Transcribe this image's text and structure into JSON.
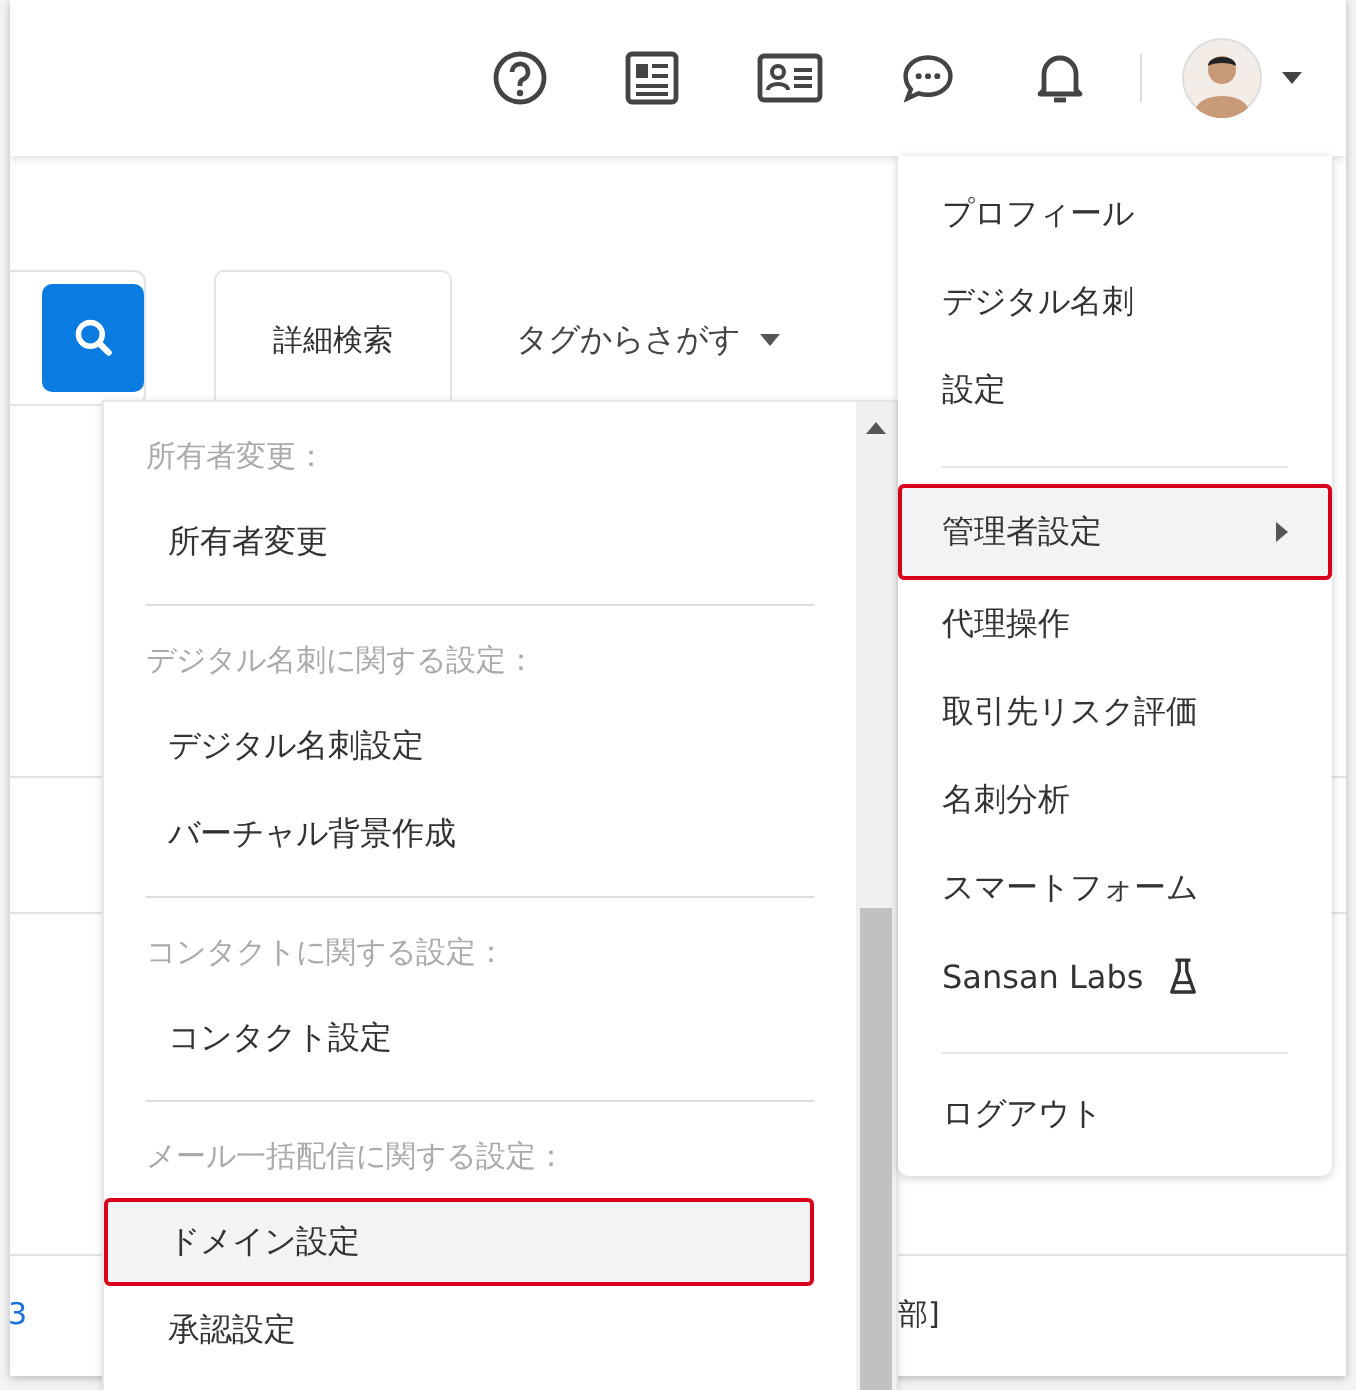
{
  "search": {
    "advanced_button": "詳細検索",
    "tag_dropdown": "タグからさがす"
  },
  "background_row": {
    "row_number": "3",
    "cell_fragment": "部]"
  },
  "admin_menu": {
    "sections": [
      {
        "heading": "所有者変更：",
        "items": [
          {
            "label": "所有者変更",
            "selected": false
          }
        ]
      },
      {
        "heading": "デジタル名刺に関する設定：",
        "items": [
          {
            "label": "デジタル名刺設定",
            "selected": false
          },
          {
            "label": "バーチャル背景作成",
            "selected": false
          }
        ]
      },
      {
        "heading": "コンタクトに関する設定：",
        "items": [
          {
            "label": "コンタクト設定",
            "selected": false
          }
        ]
      },
      {
        "heading": "メール一括配信に関する設定：",
        "items": [
          {
            "label": "ドメイン設定",
            "selected": true
          },
          {
            "label": "承認設定",
            "selected": false
          }
        ]
      }
    ]
  },
  "user_menu": {
    "groups": [
      [
        {
          "label": "プロフィール",
          "kind": "item",
          "selected": false
        },
        {
          "label": "デジタル名刺",
          "kind": "item",
          "selected": false
        },
        {
          "label": "設定",
          "kind": "item",
          "selected": false
        }
      ],
      [
        {
          "label": "管理者設定",
          "kind": "submenu",
          "selected": true
        },
        {
          "label": "代理操作",
          "kind": "item",
          "selected": false
        },
        {
          "label": "取引先リスク評価",
          "kind": "item",
          "selected": false
        },
        {
          "label": "名刺分析",
          "kind": "item",
          "selected": false
        },
        {
          "label": "スマートフォーム",
          "kind": "item",
          "selected": false
        },
        {
          "label": "Sansan Labs",
          "kind": "labs",
          "selected": false
        }
      ],
      [
        {
          "label": "ログアウト",
          "kind": "item",
          "selected": false
        }
      ]
    ]
  }
}
